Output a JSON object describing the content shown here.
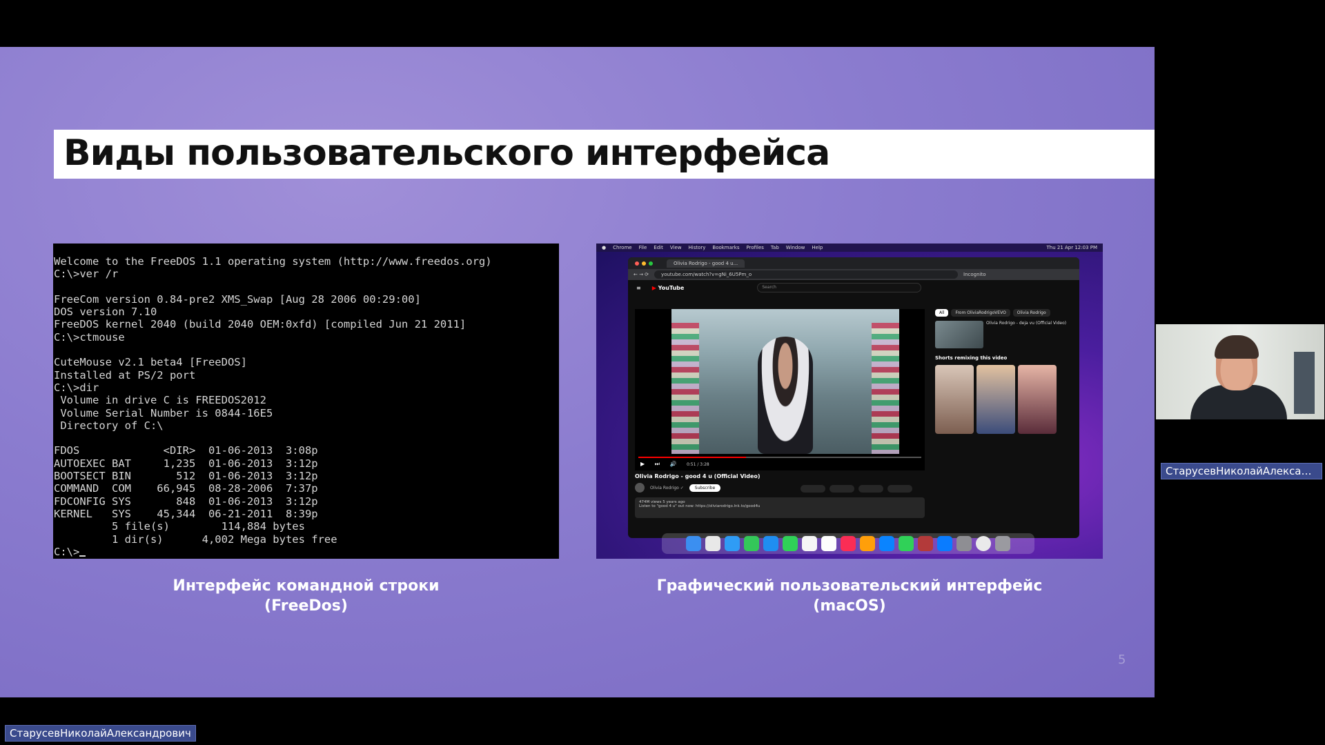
{
  "slide": {
    "title": "Виды пользовательского интерфейса",
    "page_number": "5",
    "left_caption": [
      "Интерфейс командной строки",
      "(FreeDos)"
    ],
    "right_caption": [
      "Графический пользовательский интерфейс",
      "(macOS)"
    ]
  },
  "terminal": {
    "lines": [
      "Welcome to the FreeDOS 1.1 operating system (http://www.freedos.org)",
      "C:\\>ver /r",
      "",
      "FreeCom version 0.84-pre2 XMS_Swap [Aug 28 2006 00:29:00]",
      "DOS version 7.10",
      "FreeDOS kernel 2040 (build 2040 OEM:0xfd) [compiled Jun 21 2011]",
      "C:\\>ctmouse",
      "",
      "CuteMouse v2.1 beta4 [FreeDOS]",
      "Installed at PS/2 port",
      "C:\\>dir",
      " Volume in drive C is FREEDOS2012",
      " Volume Serial Number is 0844-16E5",
      " Directory of C:\\",
      "",
      "FDOS             <DIR>  01-06-2013  3:08p",
      "AUTOEXEC BAT     1,235  01-06-2013  3:12p",
      "BOOTSECT BIN       512  01-06-2013  3:12p",
      "COMMAND  COM    66,945  08-28-2006  7:37p",
      "FDCONFIG SYS       848  01-06-2013  3:12p",
      "KERNEL   SYS    45,344  06-21-2011  8:39p",
      "         5 file(s)        114,884 bytes",
      "         1 dir(s)      4,002 Mega bytes free"
    ],
    "prompt": "C:\\>"
  },
  "mac": {
    "menubar": [
      "Chrome",
      "File",
      "Edit",
      "View",
      "History",
      "Bookmarks",
      "Profiles",
      "Tab",
      "Window",
      "Help"
    ],
    "clock": "Thu 21 Apr 12:03 PM",
    "tab_title": "Olivia Rodrigo - good 4 u...",
    "url": "youtube.com/watch?v=gNi_6U5Pm_o",
    "incognito": "Incognito",
    "yt_logo": "YouTube",
    "search_placeholder": "Search",
    "time": "0:51 / 3:28",
    "video_title": "Olivia Rodrigo - good 4 u (Official Video)",
    "channel": "Olivia Rodrigo ✓",
    "subscribe": "Subscribe",
    "views": "474M views  5 years ago",
    "desc_line": "Listen to \"good 4 u\" out now: https://oliviarodrigo.lnk.to/good4u",
    "chips": [
      "All",
      "From OliviaRodrigoVEVO",
      "Olivia Rodrigo"
    ],
    "rec_title": "Olivia Rodrigo - deja vu (Official Video)",
    "shorts_title": "Shorts remixing this video"
  },
  "call": {
    "speaker_tag": "СтарусевНиколайАлексан...",
    "self_tag": "СтарусевНиколайАлександрович"
  },
  "colors": {
    "slide_bg": "#8b7ccf",
    "terminal_bg": "#000000",
    "tag_bg": "#3a4a8c"
  }
}
